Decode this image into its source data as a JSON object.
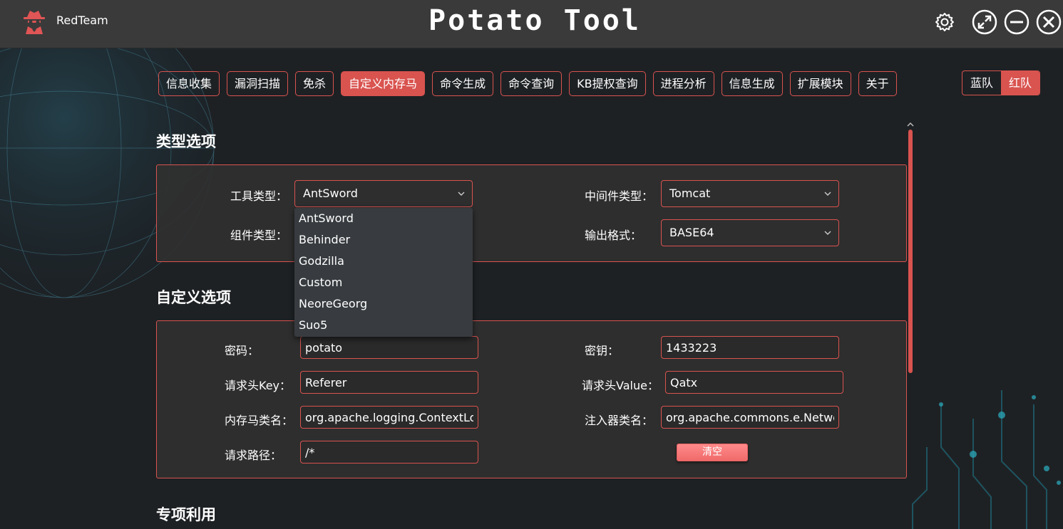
{
  "app": {
    "name": "RedTeam",
    "title": "Potato Tool",
    "accent": "#d9534f"
  },
  "nav": {
    "tabs": [
      {
        "label": "信息收集",
        "active": false
      },
      {
        "label": "漏洞扫描",
        "active": false
      },
      {
        "label": "免杀",
        "active": false
      },
      {
        "label": "自定义内存马",
        "active": true
      },
      {
        "label": "命令生成",
        "active": false
      },
      {
        "label": "命令查询",
        "active": false
      },
      {
        "label": "KB提权查询",
        "active": false
      },
      {
        "label": "进程分析",
        "active": false
      },
      {
        "label": "信息生成",
        "active": false
      },
      {
        "label": "扩展模块",
        "active": false
      },
      {
        "label": "关于",
        "active": false
      }
    ],
    "team": {
      "blue": "蓝队",
      "red": "红队",
      "selected": "red"
    }
  },
  "type_section": {
    "title": "类型选项",
    "tool_type_label": "工具类型：",
    "tool_type_value": "AntSword",
    "middleware_label": "中间件类型：",
    "middleware_value": "Tomcat",
    "component_label": "组件类型：",
    "output_label": "输出格式：",
    "output_value": "BASE64"
  },
  "dropdown": {
    "options": [
      "AntSword",
      "Behinder",
      "Godzilla",
      "Custom",
      "NeoreGeorg",
      "Suo5"
    ]
  },
  "custom_section": {
    "title": "自定义选项",
    "password_label": "密码：",
    "password_value": "potato",
    "key_label": "密钥：",
    "key_value": "1433223",
    "header_key_label": "请求头Key：",
    "header_key_value": "Referer",
    "header_value_label": "请求头Value：",
    "header_value_value": "Qatx",
    "shell_class_label": "内存马类名：",
    "shell_class_value": "org.apache.logging.ContextLoa",
    "injector_class_label": "注入器类名：",
    "injector_class_value": "org.apache.commons.e.Networ",
    "path_label": "请求路径：",
    "path_value": "/*",
    "clear_label": "清空"
  },
  "special_section": {
    "title": "专项利用"
  },
  "icons": {
    "logo": "spy-hacker-icon",
    "settings": "gear-icon",
    "maximize": "maximize-icon",
    "minimize": "minimize-icon",
    "close": "close-icon",
    "dropdown": "chevron-down-icon"
  }
}
